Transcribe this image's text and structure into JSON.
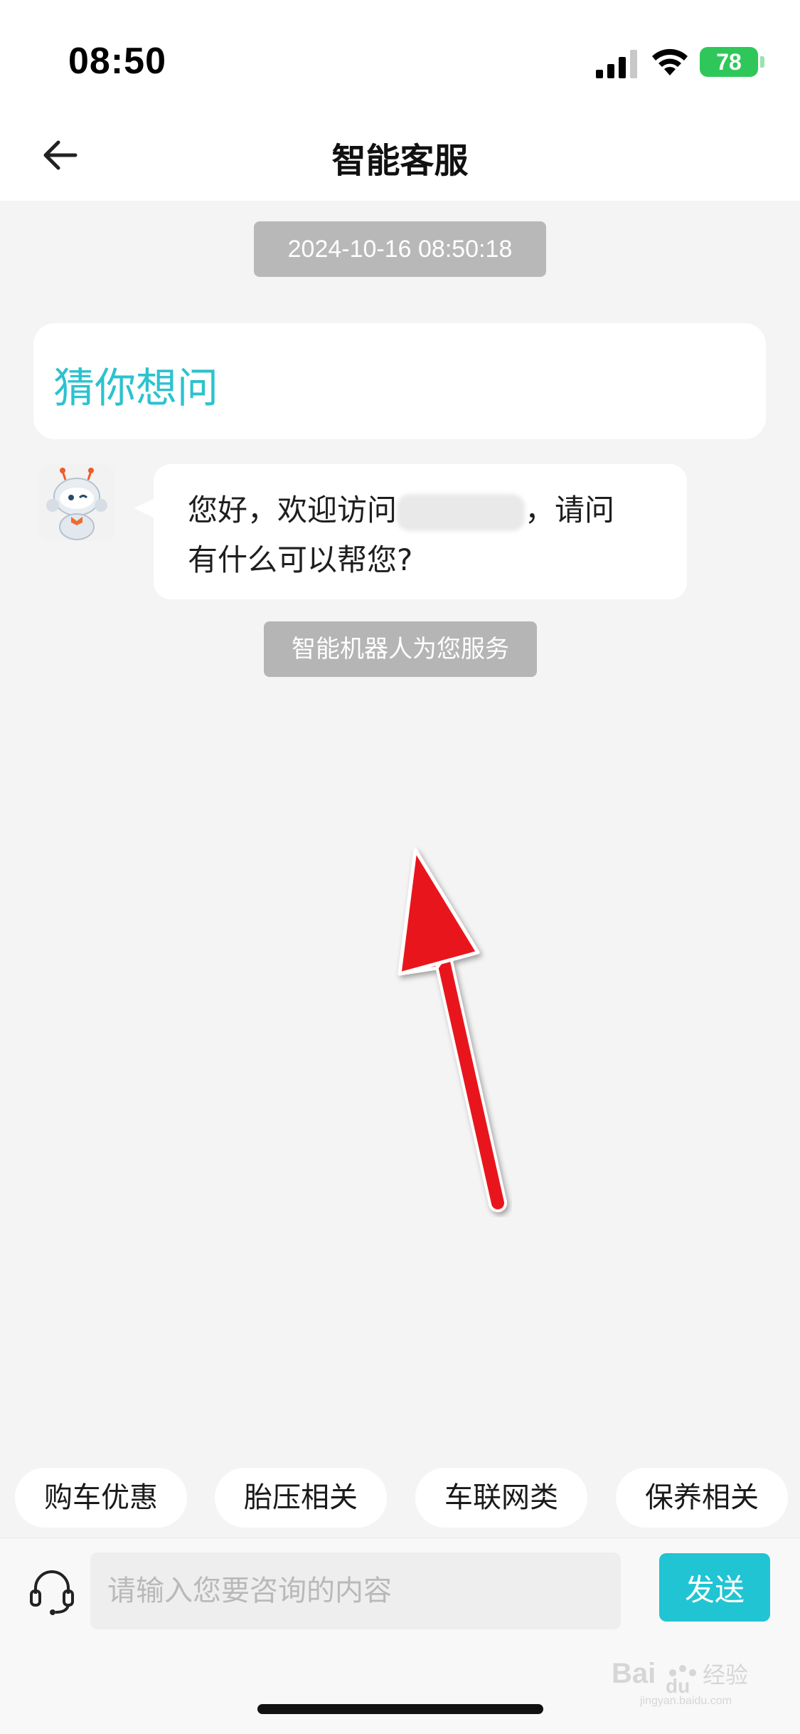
{
  "status_bar": {
    "time": "08:50",
    "battery": "78",
    "icons": [
      "signal-icon",
      "wifi-icon",
      "battery-icon"
    ]
  },
  "nav": {
    "title": "智能客服",
    "back_icon": "back-arrow-icon"
  },
  "chat": {
    "timestamp": "2024-10-16 08:50:18",
    "guess_title": "猜你想问",
    "bot_message": {
      "line1_prefix": "您好，欢迎访问",
      "line1_suffix": "，请问",
      "line2": "有什么可以帮您?"
    },
    "robot_badge": "智能机器人为您服务"
  },
  "quick_replies": [
    "购车优惠",
    "胎压相关",
    "车联网类",
    "保养相关"
  ],
  "input": {
    "placeholder": "请输入您要咨询的内容",
    "send_label": "发送",
    "headset_icon": "headset-icon"
  },
  "watermark": {
    "brand": "Bai",
    "paw": "du",
    "cn": "经验",
    "url": "jingyan.baidu.com"
  },
  "colors": {
    "accent": "#21c4d2",
    "guess_title": "#2cc2cf",
    "arrow": "#e8141b",
    "battery": "#30c75a"
  }
}
